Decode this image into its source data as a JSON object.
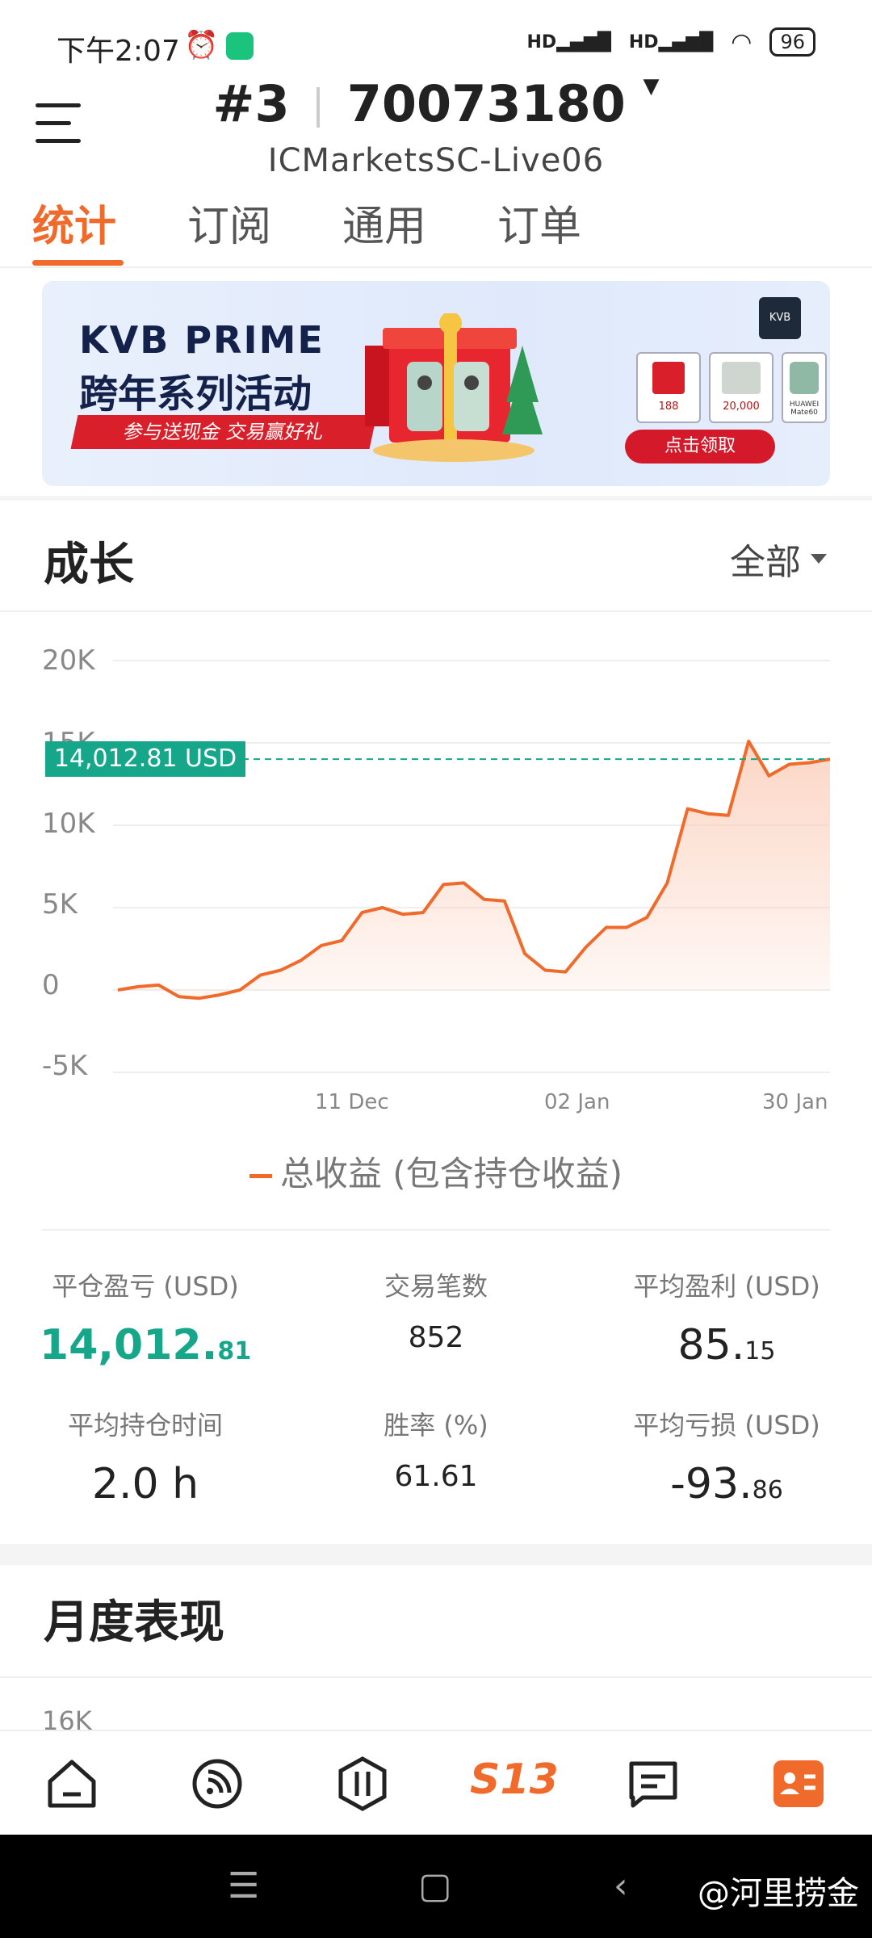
{
  "status": {
    "time": "下午2:07",
    "battery": "96",
    "signal1": "HD",
    "signal2": "HD"
  },
  "header": {
    "account_prefix": "#3",
    "account_number": "70073180",
    "server": "ICMarketsSC-Live06"
  },
  "tabs": [
    "统计",
    "订阅",
    "通用",
    "订单"
  ],
  "banner": {
    "brand": "KVB PRIME",
    "headline": "跨年系列活动",
    "ribbon": "参与送现金 交易赢好礼",
    "logo": "KVB",
    "prizes": [
      "188",
      "20,000",
      "HUAWEI Mate60"
    ],
    "cta": "点击领取"
  },
  "growth": {
    "title": "成长",
    "range": "全部",
    "current_value_label": "14,012.81 USD",
    "legend": "总收益 (包含持仓收益)"
  },
  "chart_data": {
    "type": "area",
    "yticks": [
      "20K",
      "15K",
      "10K",
      "5K",
      "0",
      "-5K"
    ],
    "xticks": [
      "11 Dec",
      "02 Jan",
      "30 Jan"
    ],
    "ylim": [
      -5000,
      20000
    ],
    "series": [
      {
        "name": "总收益 (包含持仓收益)",
        "values": [
          0,
          200,
          300,
          -400,
          -500,
          -300,
          0,
          900,
          1200,
          1800,
          2700,
          3000,
          4700,
          5000,
          4600,
          4700,
          6400,
          6500,
          5500,
          5400,
          2200,
          1200,
          1100,
          2600,
          3800,
          3800,
          4400,
          6500,
          11000,
          10700,
          10600,
          15100,
          13000,
          13700,
          13800,
          14012.81
        ]
      }
    ],
    "reference_line": 14012.81,
    "colors": {
      "line": "#f06a2c",
      "fill": "#fbd2bf",
      "reference": "#16a68a"
    }
  },
  "stats": {
    "closed_pnl": {
      "label": "平仓盈亏 (USD)",
      "main": "14,012.",
      "frac": "81"
    },
    "trades": {
      "label": "交易笔数",
      "value": "852"
    },
    "avg_profit": {
      "label": "平均盈利 (USD)",
      "main": "85.",
      "frac": "15"
    },
    "avg_hold": {
      "label": "平均持仓时间",
      "value": "2.0 h"
    },
    "win_rate": {
      "label": "胜率 (%)",
      "value": "61.61"
    },
    "avg_loss": {
      "label": "平均亏损 (USD)",
      "main": "-93.",
      "frac": "86"
    }
  },
  "monthly": {
    "title": "月度表现",
    "partial_tick": "16K"
  },
  "nav": {
    "items": [
      "home-icon",
      "feed-icon",
      "trade-icon",
      "s13-icon",
      "message-icon",
      "profile-icon"
    ],
    "s13_label": "S13"
  },
  "watermark": "@河里捞金"
}
